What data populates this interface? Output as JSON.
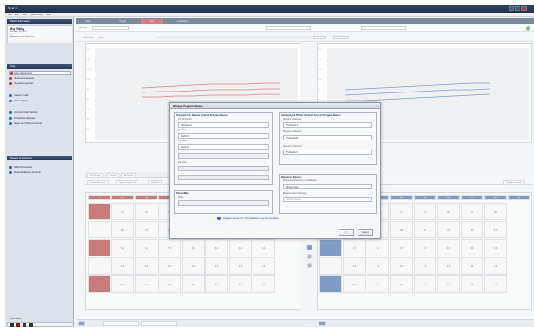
{
  "app": {
    "title": "Noah 4",
    "menu": [
      "File",
      "Edit",
      "View",
      "Quick Fitting",
      "Help"
    ]
  },
  "sidebar": {
    "header_patient": "Patient Information",
    "patient": {
      "name": "Boy Baby",
      "lines": [
        "Birthdate: 6/1/2014",
        "Age: 1",
        "Experience: First Time User"
      ]
    },
    "header_tools": "Tools",
    "tools": [
      {
        "label": "Gain Adjustment",
        "selected": true,
        "color": "#c0392b"
      },
      {
        "label": "Advanced Features",
        "selected": false,
        "color": "#c0392b"
      },
      {
        "label": "Physical Properties",
        "selected": false,
        "color": "#c0392b"
      },
      {
        "label": "Feature Guide",
        "selected": false,
        "color": "#2e6db4"
      },
      {
        "label": "Data Logging",
        "selected": false,
        "color": "#2e6db4"
      },
      {
        "label": "Environmental Selector",
        "selected": false,
        "color": "#2e6db4"
      },
      {
        "label": "Microphone Manager",
        "selected": false,
        "color": "#2e6db4"
      },
      {
        "label": "Beeps and Volume Control",
        "selected": false,
        "color": "#2e6db4"
      }
    ],
    "header_accessories": "Manage Accessories",
    "accessories": [
      "SDM Accessories",
      "Bluetooth Stereo Controls"
    ],
    "footer_label": "Quick Guard"
  },
  "main": {
    "tabs": [
      {
        "label": "Start",
        "active": false
      },
      {
        "label": "Pre-Fit",
        "active": false
      },
      {
        "label": "Fit",
        "active": true
      },
      {
        "label": "Conclusion",
        "active": false
      }
    ],
    "toolbar": {
      "left_ear_label": "Right Ear",
      "mode_label": "Change Channels",
      "view_options": [
        "Gain Values",
        "Output"
      ]
    },
    "graph_ticks": [
      "130",
      "120",
      "110",
      "100",
      "90",
      "80",
      "70",
      "60",
      "50"
    ],
    "left_subtabs": [
      "Soft Sounds",
      "Normal",
      "All Sounds"
    ],
    "left_subtabs2": [
      "Change All Levels",
      "Patient Comparison",
      "Individual"
    ],
    "right_subtabs2": [
      "Change Individual"
    ],
    "left_grid": {
      "header_values": [
        "-6",
        "3.4",
        "-12",
        "-6",
        "-5",
        "5.2",
        "3.4",
        "-7",
        "-5"
      ],
      "rows": [
        [
          "78",
          "66",
          "72",
          "68",
          "58",
          "36",
          "5"
        ],
        [
          "80",
          "78",
          "19",
          "78",
          "78",
          "65",
          "3"
        ],
        [
          "5.2",
          "6.0",
          "7.8",
          "6.0",
          "8.0",
          "6.0",
          "6.0"
        ],
        [
          "3.6",
          "3.6",
          "3.6",
          "3.6",
          "3.6",
          "3.6",
          "3.6"
        ],
        [
          "8.0",
          "13",
          "7.8",
          "8.0",
          "8.0",
          "8.0",
          "8.0"
        ]
      ]
    },
    "right_grid": {
      "header_values": [
        "38",
        "37",
        "39",
        "38",
        "40",
        "40",
        "35",
        "35",
        "40"
      ],
      "rows": [
        [
          "37",
          "4.2",
          "37",
          "37",
          "35",
          "36",
          "38"
        ],
        [
          "37",
          "4.7",
          "48",
          "40",
          "37",
          "5.0",
          "5.1"
        ],
        [
          "4.5",
          "11",
          "33",
          "3.8",
          "3.5",
          "4.3",
          "3.6"
        ],
        [
          "3.6",
          "3.6",
          "3.6",
          "3.6",
          "3.6",
          "3.6",
          "3.6"
        ],
        [
          "8.0",
          "12",
          "3.6",
          "3.6",
          "1.6",
          "2.5",
          "1.0"
        ]
      ]
    }
  },
  "dialog": {
    "title": "Manage Program Names",
    "group_left_title": "Program 1-4: Remote Control Program Names",
    "left_fields": [
      {
        "label": "P1: All Around",
        "value": "All Around"
      },
      {
        "label": "P2: Kid",
        "value": "Kid's Ch"
      },
      {
        "label": "P3: None",
        "value": "Audio In"
      },
      {
        "label": "P4: None",
        "value": ""
      }
    ],
    "group_right_title": "Streaming & Phone: Remote Control Program Names",
    "right_fields": [
      {
        "label": "Streamer Channel 1",
        "value": "TV/Stereo A"
      },
      {
        "label": "Streamer Channel 2",
        "value": "TV/Media B"
      },
      {
        "label": "Streamer Channel 3",
        "value": "TV/Media C"
      }
    ],
    "group_phone_title": "PhoneMate",
    "phone_fields": [
      {
        "label": "None",
        "value": ""
      }
    ],
    "group_bt_title": "Bluetooth Devices",
    "bt_fields": [
      {
        "label": "Phone Car Phone Car / Gold Device",
        "value": "Phone Clips"
      },
      {
        "label": "Bluetooth Devs (Service)",
        "value": "Sample Device"
      }
    ],
    "note": "Program names over 10 characters may be truncated.",
    "ok_label": "OK",
    "cancel_label": "Cancel"
  }
}
